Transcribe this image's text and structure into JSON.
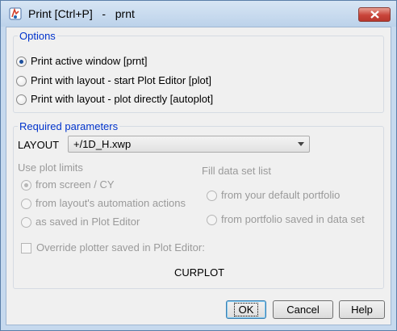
{
  "window": {
    "title": "Print [Ctrl+P]   -   prnt"
  },
  "options": {
    "legend": "Options",
    "radios": [
      {
        "label": "Print active window [prnt]",
        "checked": true
      },
      {
        "label": "Print with layout - start Plot Editor [plot]",
        "checked": false
      },
      {
        "label": "Print with layout - plot directly [autoplot]",
        "checked": false
      }
    ]
  },
  "params": {
    "legend": "Required parameters",
    "layout_label": "LAYOUT",
    "layout_value": "+/1D_H.xwp",
    "use_plot_limits": {
      "heading": "Use plot limits",
      "radios": [
        {
          "label": "from screen / CY",
          "checked": true
        },
        {
          "label": "from layout's automation actions",
          "checked": false
        },
        {
          "label": "as saved in Plot Editor",
          "checked": false
        }
      ]
    },
    "fill_data_set": {
      "heading": "Fill data set list",
      "radios": [
        {
          "label": "from your default portfolio",
          "checked": false
        },
        {
          "label": "from portfolio saved in data set",
          "checked": false
        }
      ]
    },
    "override_label": "Override plotter saved in Plot Editor:",
    "plotter_value": "CURPLOT"
  },
  "buttons": {
    "ok": "OK",
    "cancel": "Cancel",
    "help": "Help"
  },
  "icons": {
    "app": "app-icon",
    "close": "close-icon"
  },
  "colors": {
    "accent": "#0033cc",
    "close_button": "#c9443a"
  }
}
